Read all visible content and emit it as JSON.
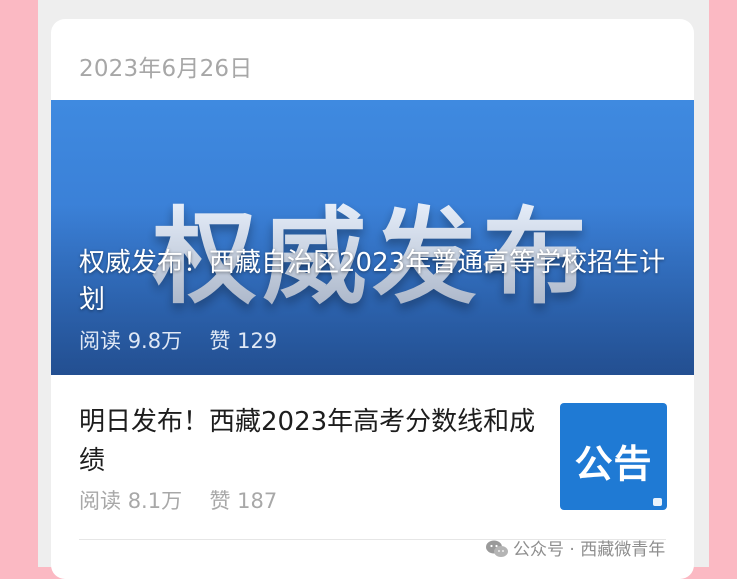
{
  "date": "2023年6月26日",
  "hero": {
    "bg_text": "权威发布",
    "title": "权威发布！西藏自治区2023年普通高等学校招生计划",
    "read_label": "阅读",
    "read_count": "9.8万",
    "like_label": "赞",
    "like_count": "129",
    "color": "#3a7fd6"
  },
  "item": {
    "title": "明日发布！西藏2023年高考分数线和成绩",
    "read_label": "阅读",
    "read_count": "8.1万",
    "like_label": "赞",
    "like_count": "187",
    "thumb_text": "公告",
    "thumb_color": "#1f7ad4"
  },
  "watermark": {
    "icon": "wechat-icon",
    "text": "公众号 · 西藏微青年"
  }
}
